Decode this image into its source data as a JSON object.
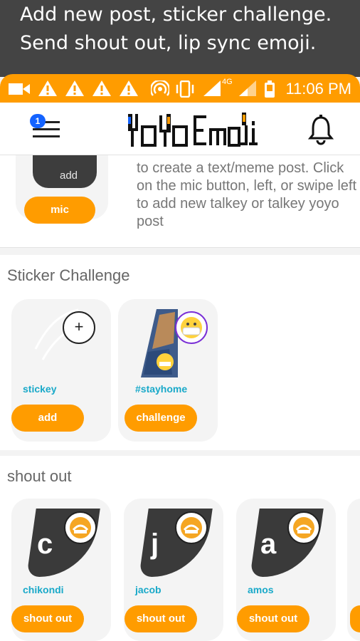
{
  "caption": {
    "line1": "Add new post, sticker challenge.",
    "line2": "Send shout out, lip sync emoji."
  },
  "status_bar": {
    "time": "11:06 PM",
    "network": "4G",
    "icons": [
      "video-icon",
      "warning-icon",
      "warning-icon",
      "warning-icon",
      "warning-icon",
      "hotspot-icon",
      "vibrate-icon",
      "signal-icon",
      "signal-icon",
      "battery-icon"
    ]
  },
  "app_bar": {
    "menu_badge": "1",
    "logo_text": "YoYo EmoJi"
  },
  "intro": {
    "bubble_label": "add",
    "mic_label": "mic",
    "text": "to create a text/meme post. Click on the mic button, left, or swipe left to add new talkey or talkey yoyo post"
  },
  "sticker_challenge": {
    "title": "Sticker Challenge",
    "cards": [
      {
        "name": "stickey",
        "button": "add"
      },
      {
        "name": "#stayhome",
        "button": "challenge"
      }
    ]
  },
  "shout_out": {
    "title": "shout out",
    "cards": [
      {
        "letter": "c",
        "name": "chikondi",
        "button": "shout out"
      },
      {
        "letter": "j",
        "name": "jacob",
        "button": "shout out"
      },
      {
        "letter": "a",
        "name": "amos",
        "button": "shout out"
      }
    ]
  },
  "colors": {
    "accent": "#ff9c00",
    "link": "#19a9c9",
    "dark": "#3a3a3a"
  }
}
